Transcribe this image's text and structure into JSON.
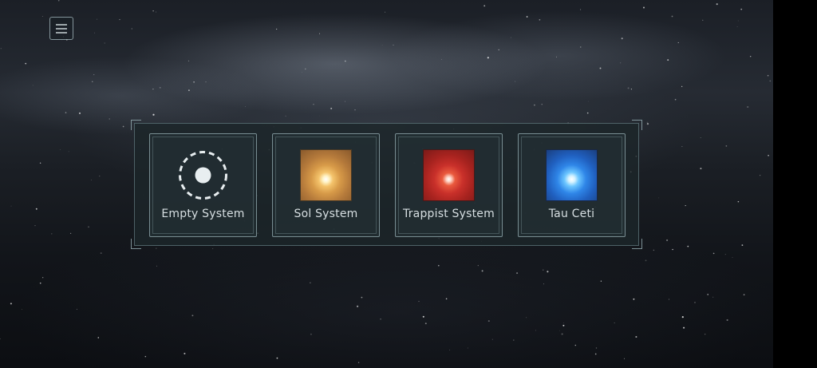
{
  "header": {
    "menu_icon": "hamburger-menu-icon"
  },
  "systems": [
    {
      "label": "Empty System",
      "icon": "empty-system-icon"
    },
    {
      "label": "Sol System",
      "icon": "sol-star-icon",
      "color": "#e8b060"
    },
    {
      "label": "Trappist System",
      "icon": "trappist-star-icon",
      "color": "#c9302a"
    },
    {
      "label": "Tau Ceti",
      "icon": "tau-ceti-star-icon",
      "color": "#2f86e8"
    }
  ]
}
